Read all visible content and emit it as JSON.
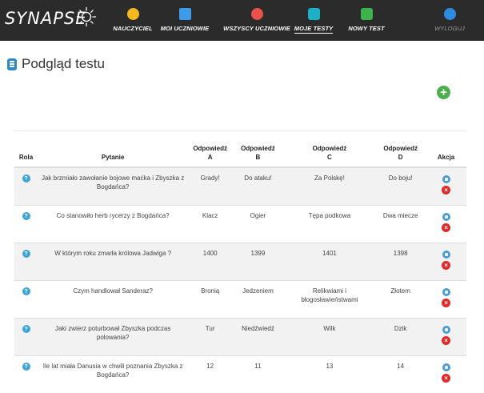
{
  "brand": {
    "name": "SYNAPSE"
  },
  "nav": {
    "items": [
      {
        "label": "NAUCZYCIEL",
        "icon": "teacher-icon",
        "color": "#f5b820"
      },
      {
        "label": "MOI UCZNIOWIE",
        "icon": "students-icon",
        "color": "#3d9be9"
      },
      {
        "label": "WSZYSCY UCZNIOWIE",
        "icon": "all-students-icon",
        "color": "#e8524a"
      },
      {
        "label": "MOJE TESTY",
        "icon": "tests-icon",
        "color": "#1ab0c8"
      },
      {
        "label": "NOWY TEST",
        "icon": "new-test-icon",
        "color": "#3cb44b"
      },
      {
        "label": "WYLOGUJ",
        "icon": "logout-icon",
        "color": "#2d8ce0"
      }
    ],
    "active": "MOJE TESTY"
  },
  "page": {
    "title": "Podgląd testu",
    "add_label": "+"
  },
  "table": {
    "headers": {
      "rola": "Rola",
      "pytanie": "Pytanie",
      "a": [
        "Odpowiedź",
        "A"
      ],
      "b": [
        "Odpowiedź",
        "B"
      ],
      "c": [
        "Odpowiedź",
        "C"
      ],
      "d": [
        "Odpowiedź",
        "D"
      ],
      "akcja": "Akcja"
    },
    "rows": [
      {
        "question": "Jak brzmiało zawołanie bojowe maćka i Zbyszka z Bogdańca?",
        "a": "Grady!",
        "b": "Do ataku!",
        "c": "Za Polskę!",
        "d": "Do boju!"
      },
      {
        "question": "Co stanowiło herb rycerzy z Bogdańca?",
        "a": "Klacz",
        "b": "Ogier",
        "c": "Tępa podkowa",
        "d": "Dwa miecze"
      },
      {
        "question": "W którym roku zmarła królowa Jadwiga ?",
        "a": "1400",
        "b": "1399",
        "c": "1401",
        "d": "1398"
      },
      {
        "question": "Czym handlował Sanderaz?",
        "a": "Bronią",
        "b": "Jedzeniem",
        "c": "Relikwiami i błogosławieństwami",
        "d": "Złotem"
      },
      {
        "question": "Jaki zwierz poturbował Zbyszka podczas polowania?",
        "a": "Tur",
        "b": "Niedźwiedź",
        "c": "Wilk",
        "d": "Dzik"
      },
      {
        "question": "Ile lat miała Danusia w chwili poznania Zbyszka z Bogdańca?",
        "a": "12",
        "b": "11",
        "c": "13",
        "d": "14"
      }
    ],
    "role_icon": "?",
    "delete_icon": "×"
  }
}
